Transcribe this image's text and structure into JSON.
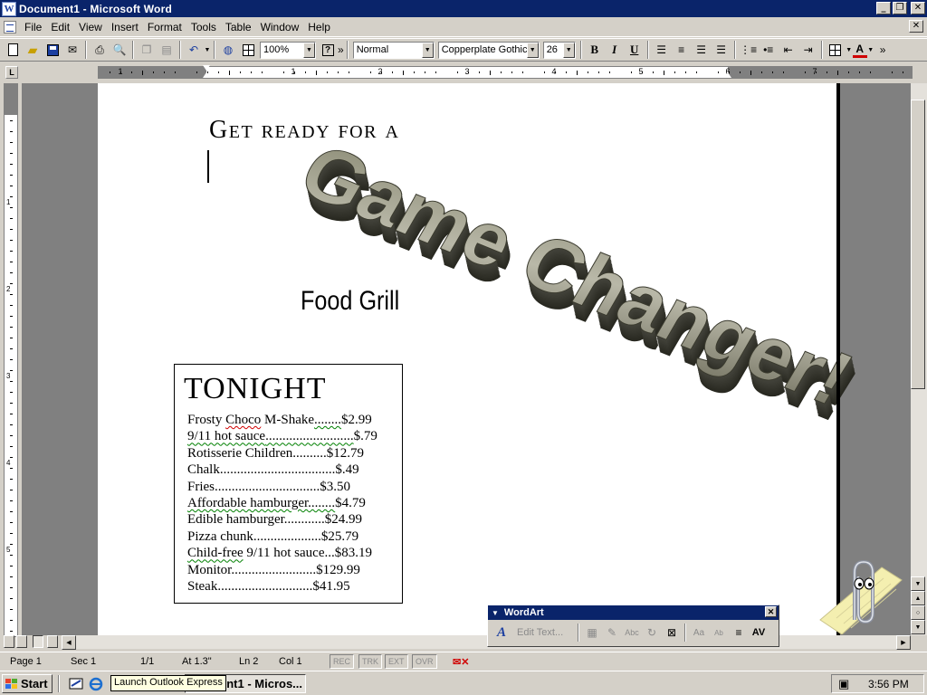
{
  "window": {
    "title": "Document1 - Microsoft Word",
    "app_icon": "W",
    "minimize_icon": "minimize-icon",
    "restore_icon": "restore-icon",
    "close_icon": "close-icon"
  },
  "menu": {
    "items": [
      "File",
      "Edit",
      "View",
      "Insert",
      "Format",
      "Tools",
      "Table",
      "Window",
      "Help"
    ],
    "close_doc_icon": "close-icon"
  },
  "toolbar": {
    "zoom": "100%",
    "style": "Normal",
    "font": "Copperplate Gothic",
    "font_size": "26",
    "bold_label": "B",
    "italic_label": "I",
    "underline_label": "U",
    "font_color_label": "A",
    "font_color": "#d00000",
    "help_label": "?",
    "overflow_label": "»"
  },
  "ruler": {
    "numbers": [
      "1",
      "1",
      "2",
      "3",
      "4",
      "5",
      "6",
      "7"
    ],
    "vertical_numbers": [
      "1",
      "2",
      "3",
      "4",
      "5"
    ],
    "corner_label": "L"
  },
  "document": {
    "headline": "Get ready for a",
    "wordart_text": "Game Changer!",
    "subtitle": "Food Grill",
    "menu_heading": "TONIGHT",
    "menu_items": [
      {
        "name": "Frosty ",
        "flag": "Choco",
        "rest": " M-Shake",
        "leader": "........",
        "price": "$2.99",
        "squiggle": "red"
      },
      {
        "name": "9/11 hot sauce",
        "leader": "..........................",
        "price": "$.79",
        "squiggle": "green-all"
      },
      {
        "name": "Rotisserie Children",
        "leader": "..........",
        "price": "$12.79",
        "squiggle": "none"
      },
      {
        "name": "Chalk",
        "leader": "..................................",
        "price": "$.49",
        "squiggle": "none"
      },
      {
        "name": "Fries",
        "leader": "...............................",
        "price": "$3.50",
        "squiggle": "none"
      },
      {
        "name": "Affordable hamburger",
        "leader": "........",
        "price": "$4.79",
        "squiggle": "green-name"
      },
      {
        "name": "Edible hamburger",
        "leader": "............",
        "price": "$24.99",
        "squiggle": "none"
      },
      {
        "name": "Pizza chunk",
        "leader": "....................",
        "price": "$25.79",
        "squiggle": "none"
      },
      {
        "name": "Child-free",
        "rest": " 9/11 hot sauce",
        "leader": "...",
        "price": "$83.19",
        "squiggle": "green-first"
      },
      {
        "name": "Monitor",
        "leader": ".........................",
        "price": "$129.99",
        "squiggle": "none"
      },
      {
        "name": "Steak",
        "leader": "............................",
        "price": "$41.95",
        "squiggle": "none"
      }
    ]
  },
  "status": {
    "page": "Page  1",
    "sec": "Sec  1",
    "pages": "1/1",
    "at": "At  1.3\"",
    "ln": "Ln  2",
    "col": "Col  1",
    "rec": "REC",
    "trk": "TRK",
    "ext": "EXT",
    "ovr": "OVR"
  },
  "wordart_toolbar": {
    "title": "WordArt",
    "edit_text": "Edit Text...",
    "collapse_icon": "triangle-down-icon"
  },
  "taskbar": {
    "start_label": "Start",
    "task_label": "ent1 - Micros...",
    "tooltip": "Launch Outlook Express",
    "time": "3:56 PM"
  }
}
